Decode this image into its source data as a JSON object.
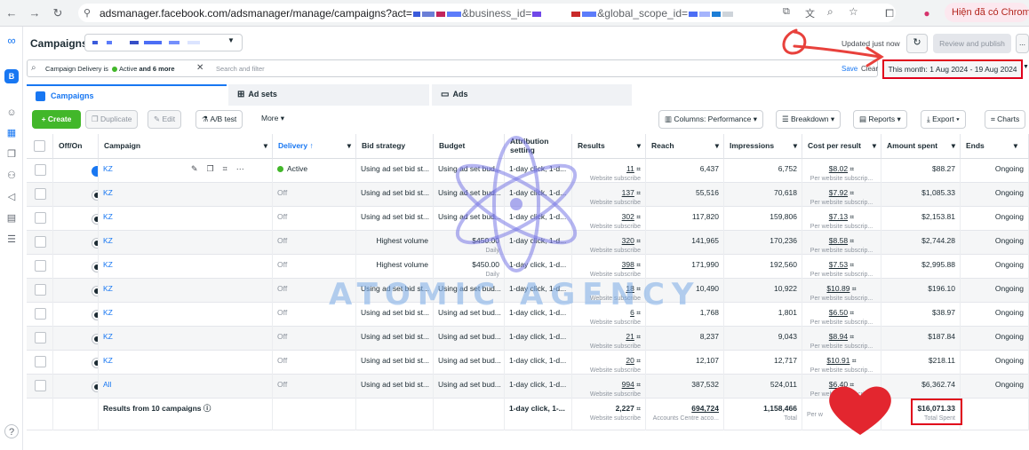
{
  "browser": {
    "url_prefix": "adsmanager.facebook.com/adsmanager/manage/campaigns?act=",
    "url_mid1": "&business_id=",
    "url_mid2": "&global_scope_id=",
    "profile_label": "Hiện đã có Chrome m"
  },
  "header": {
    "title": "Campaigns",
    "updated": "Updated just now",
    "review_publish": "Review and publish",
    "more": "..."
  },
  "filter": {
    "chip_prefix": "Campaign Delivery is",
    "chip_active": "Active",
    "chip_more": "and 6 more",
    "placeholder": "Search and filter",
    "save": "Save",
    "clear": "Clear",
    "date_range": "This month: 1 Aug 2024 - 19 Aug 2024"
  },
  "tabs": [
    {
      "label": "Campaigns"
    },
    {
      "label": "Ad sets"
    },
    {
      "label": "Ads"
    }
  ],
  "toolbar": {
    "create": "Create",
    "duplicate": "Duplicate",
    "edit": "Edit",
    "ab_test": "A/B test",
    "more": "More",
    "columns": "Columns: Performance",
    "breakdown": "Breakdown",
    "reports": "Reports",
    "export": "Export",
    "charts": "Charts"
  },
  "columns": {
    "offon": "Off/On",
    "campaign": "Campaign",
    "delivery": "Delivery ↑",
    "bid": "Bid strategy",
    "budget": "Budget",
    "attribution": "Attribution setting",
    "results": "Results",
    "reach": "Reach",
    "impressions": "Impressions",
    "cpr": "Cost per result",
    "spent": "Amount spent",
    "ends": "Ends"
  },
  "rows": [
    {
      "name": "KZ",
      "on": true,
      "delivery": "Active",
      "bid": "Using ad set bid st...",
      "budget": "Using ad set bud...",
      "budget_sub": "",
      "attr": "1-day click, 1-d...",
      "results": "11",
      "results_sub": "Website subscribe",
      "reach": "6,437",
      "impr": "6,752",
      "cpr": "$8.02",
      "cpr_sub": "Per website subscrip...",
      "spent": "$88.27",
      "ends": "Ongoing"
    },
    {
      "name": "KZ",
      "on": false,
      "delivery": "Off",
      "bid": "Using ad set bid st...",
      "budget": "Using ad set bud...",
      "budget_sub": "",
      "attr": "1-day click, 1-d...",
      "results": "137",
      "results_sub": "Website subscribe",
      "reach": "55,516",
      "impr": "70,618",
      "cpr": "$7.92",
      "cpr_sub": "Per website subscrip...",
      "spent": "$1,085.33",
      "ends": "Ongoing"
    },
    {
      "name": "KZ",
      "on": false,
      "delivery": "Off",
      "bid": "Using ad set bid st...",
      "budget": "Using ad set bud...",
      "budget_sub": "",
      "attr": "1-day click, 1-d...",
      "results": "302",
      "results_sub": "Website subscribe",
      "reach": "117,820",
      "impr": "159,806",
      "cpr": "$7.13",
      "cpr_sub": "Per website subscrip...",
      "spent": "$2,153.81",
      "ends": "Ongoing"
    },
    {
      "name": "KZ",
      "on": false,
      "delivery": "Off",
      "bid": "Highest volume",
      "budget": "$450.00",
      "budget_sub": "Daily",
      "attr": "1-day click, 1-d...",
      "results": "320",
      "results_sub": "Website subscribe",
      "reach": "141,965",
      "impr": "170,236",
      "cpr": "$8.58",
      "cpr_sub": "Per website subscrip...",
      "spent": "$2,744.28",
      "ends": "Ongoing"
    },
    {
      "name": "KZ",
      "on": false,
      "delivery": "Off",
      "bid": "Highest volume",
      "budget": "$450.00",
      "budget_sub": "Daily",
      "attr": "1-day click, 1-d...",
      "results": "398",
      "results_sub": "Website subscribe",
      "reach": "171,990",
      "impr": "192,560",
      "cpr": "$7.53",
      "cpr_sub": "Per website subscrip...",
      "spent": "$2,995.88",
      "ends": "Ongoing"
    },
    {
      "name": "KZ",
      "on": false,
      "delivery": "Off",
      "bid": "Using ad set bid st...",
      "budget": "Using ad set bud...",
      "budget_sub": "",
      "attr": "1-day click, 1-d...",
      "results": "18",
      "results_sub": "Website subscribe",
      "reach": "10,490",
      "impr": "10,922",
      "cpr": "$10.89",
      "cpr_sub": "Per website subscrip...",
      "spent": "$196.10",
      "ends": "Ongoing"
    },
    {
      "name": "KZ",
      "on": false,
      "delivery": "Off",
      "bid": "Using ad set bid st...",
      "budget": "Using ad set bud...",
      "budget_sub": "",
      "attr": "1-day click, 1-d...",
      "results": "6",
      "results_sub": "Website subscribe",
      "reach": "1,768",
      "impr": "1,801",
      "cpr": "$6.50",
      "cpr_sub": "Per website subscrip...",
      "spent": "$38.97",
      "ends": "Ongoing"
    },
    {
      "name": "KZ",
      "on": false,
      "delivery": "Off",
      "bid": "Using ad set bid st...",
      "budget": "Using ad set bud...",
      "budget_sub": "",
      "attr": "1-day click, 1-d...",
      "results": "21",
      "results_sub": "Website subscribe",
      "reach": "8,237",
      "impr": "9,043",
      "cpr": "$8.94",
      "cpr_sub": "Per website subscrip...",
      "spent": "$187.84",
      "ends": "Ongoing"
    },
    {
      "name": "KZ",
      "on": false,
      "delivery": "Off",
      "bid": "Using ad set bid st...",
      "budget": "Using ad set bud...",
      "budget_sub": "",
      "attr": "1-day click, 1-d...",
      "results": "20",
      "results_sub": "Website subscribe",
      "reach": "12,107",
      "impr": "12,717",
      "cpr": "$10.91",
      "cpr_sub": "Per website subscrip...",
      "spent": "$218.11",
      "ends": "Ongoing"
    },
    {
      "name": "All",
      "on": false,
      "delivery": "Off",
      "bid": "Using ad set bid st...",
      "budget": "Using ad set bud...",
      "budget_sub": "",
      "attr": "1-day click, 1-d...",
      "results": "994",
      "results_sub": "Website subscribe",
      "reach": "387,532",
      "impr": "524,011",
      "cpr": "$6.40",
      "cpr_sub": "Per website subscrip...",
      "spent": "$6,362.74",
      "ends": "Ongoing"
    }
  ],
  "footer": {
    "label": "Results from 10 campaigns",
    "attr": "1-day click, 1-...",
    "results": "2,227",
    "results_sub": "Website subscribe",
    "reach": "694,724",
    "reach_sub": "Accounts Centre acco...",
    "impr": "1,158,466",
    "impr_sub": "Total",
    "cpr_sub": "Per w",
    "spent": "$16,071.33",
    "spent_sub": "Total Spent"
  },
  "watermark": "ATOMIC AGENCY",
  "colors": {
    "accent": "#1877f2",
    "green": "#42b72a",
    "annotation": "#e0001b"
  }
}
